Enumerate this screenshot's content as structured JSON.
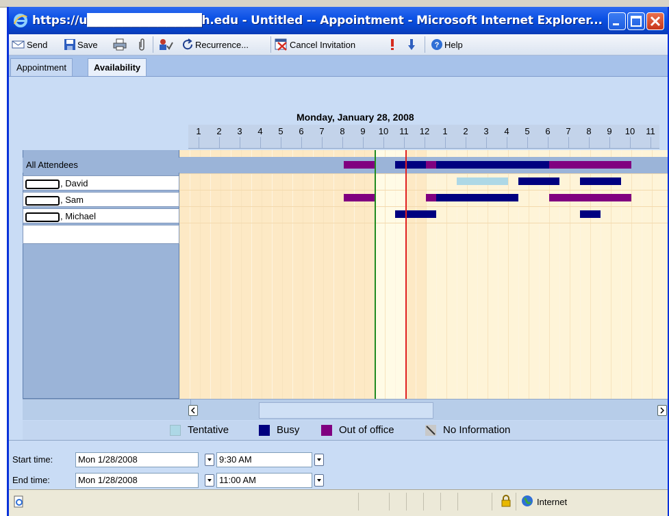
{
  "window": {
    "title": "https://u█████████████h.edu - Untitled -- Appointment - Microsoft Internet Explorer..."
  },
  "toolbar": {
    "send": "Send",
    "save": "Save",
    "recurrence": "Recurrence...",
    "cancel_invitation": "Cancel Invitation",
    "help": "Help"
  },
  "tabs": [
    {
      "label": "Appointment",
      "active": false
    },
    {
      "label": "Availability",
      "active": true
    }
  ],
  "schedule": {
    "date": "Monday, January 28, 2008",
    "hours": [
      "1",
      "2",
      "3",
      "4",
      "5",
      "6",
      "7",
      "8",
      "9",
      "10",
      "11",
      "12",
      "1",
      "2",
      "3",
      "4",
      "5",
      "6",
      "7",
      "8",
      "9",
      "10",
      "11"
    ],
    "attendees_header": "All Attendees",
    "attendees": [
      ", David",
      ", Sam",
      ", Michael"
    ],
    "meeting_start": "9:30 AM",
    "meeting_end": "11:00 AM"
  },
  "legend": {
    "tentative": "Tentative",
    "busy": "Busy",
    "out_of_office": "Out of office",
    "no_information": "No Information",
    "colors": {
      "tentative": "#add8e6",
      "busy": "#000080",
      "out_of_office": "#800080"
    }
  },
  "times": {
    "start_label": "Start time:",
    "start_date": "Mon 1/28/2008",
    "start_time": "9:30 AM",
    "end_label": "End time:",
    "end_date": "Mon 1/28/2008",
    "end_time": "11:00 AM"
  },
  "status": {
    "zone": "Internet"
  }
}
